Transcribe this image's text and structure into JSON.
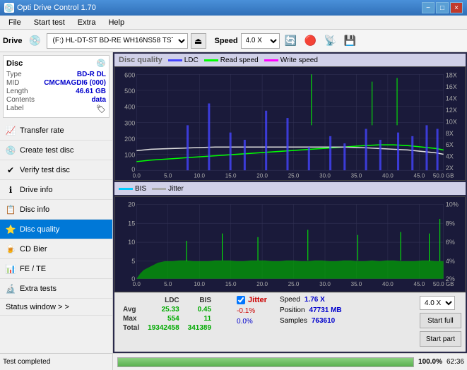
{
  "app": {
    "title": "Opti Drive Control 1.70",
    "icon": "💿"
  },
  "title_bar_controls": [
    "−",
    "□",
    "×"
  ],
  "menu": {
    "items": [
      "File",
      "Start test",
      "Extra",
      "Help"
    ]
  },
  "toolbar": {
    "drive_label": "Drive",
    "drive_value": "(F:)  HL-DT-ST BD-RE  WH16NS58 TST4",
    "speed_label": "Speed",
    "speed_value": "4.0 X"
  },
  "disc_panel": {
    "title": "Disc",
    "rows": [
      {
        "key": "Type",
        "value": "BD-R DL"
      },
      {
        "key": "MID",
        "value": "CMCMAGDI6 (000)"
      },
      {
        "key": "Length",
        "value": "46.61 GB"
      },
      {
        "key": "Contents",
        "value": "data"
      },
      {
        "key": "Label",
        "value": ""
      }
    ]
  },
  "sidebar_items": [
    {
      "id": "transfer-rate",
      "label": "Transfer rate",
      "icon": "📈"
    },
    {
      "id": "create-test-disc",
      "label": "Create test disc",
      "icon": "💿"
    },
    {
      "id": "verify-test-disc",
      "label": "Verify test disc",
      "icon": "✔"
    },
    {
      "id": "drive-info",
      "label": "Drive info",
      "icon": "ℹ"
    },
    {
      "id": "disc-info",
      "label": "Disc info",
      "icon": "📋"
    },
    {
      "id": "disc-quality",
      "label": "Disc quality",
      "icon": "⭐",
      "active": true
    },
    {
      "id": "cd-bier",
      "label": "CD Bier",
      "icon": "🍺"
    },
    {
      "id": "fe-te",
      "label": "FE / TE",
      "icon": "📊"
    },
    {
      "id": "extra-tests",
      "label": "Extra tests",
      "icon": "🔬"
    }
  ],
  "status_window": {
    "label": "Status window > >"
  },
  "chart": {
    "title": "Disc quality",
    "legend": [
      {
        "name": "LDC",
        "color": "#4444ff"
      },
      {
        "name": "Read speed",
        "color": "#00ff00"
      },
      {
        "name": "Write speed",
        "color": "#ff00ff"
      }
    ],
    "legend2": [
      {
        "name": "BIS",
        "color": "#00ccff"
      },
      {
        "name": "Jitter",
        "color": "#aaaaaa"
      }
    ],
    "top_y_labels": [
      "600",
      "500",
      "400",
      "300",
      "200",
      "100",
      "0"
    ],
    "top_y_right": [
      "18X",
      "16X",
      "14X",
      "12X",
      "10X",
      "8X",
      "6X",
      "4X",
      "2X"
    ],
    "top_x_labels": [
      "0.0",
      "5.0",
      "10.0",
      "15.0",
      "20.0",
      "25.0",
      "30.0",
      "35.0",
      "40.0",
      "45.0",
      "50.0 GB"
    ],
    "bottom_y_labels": [
      "20",
      "15",
      "10",
      "5",
      "0"
    ],
    "bottom_y_right": [
      "10%",
      "8%",
      "6%",
      "4%",
      "2%"
    ],
    "bottom_x_labels": [
      "0.0",
      "5.0",
      "10.0",
      "15.0",
      "20.0",
      "25.0",
      "30.0",
      "35.0",
      "40.0",
      "45.0",
      "50.0 GB"
    ]
  },
  "stats": {
    "headers": [
      "",
      "LDC",
      "BIS",
      "",
      "Jitter",
      "Speed",
      "1.76 X",
      "",
      "4.0 X"
    ],
    "rows": [
      {
        "label": "Avg",
        "ldc": "25.33",
        "bis": "0.45",
        "jitter": "-0.1%"
      },
      {
        "label": "Max",
        "ldc": "554",
        "bis": "11",
        "jitter": "0.0%"
      },
      {
        "label": "Total",
        "ldc": "19342458",
        "bis": "341389",
        "jitter": ""
      }
    ],
    "position_label": "Position",
    "position_value": "47731 MB",
    "samples_label": "Samples",
    "samples_value": "763610",
    "speed_label": "Speed",
    "speed_value": "1.76 X",
    "speed_max": "4.0 X",
    "jitter_checked": true,
    "jitter_label": "Jitter",
    "start_full_label": "Start full",
    "start_part_label": "Start part"
  },
  "status_bar": {
    "left_text": "Test completed",
    "progress_value": 100,
    "progress_text": "100.0%",
    "time": "62:36"
  }
}
